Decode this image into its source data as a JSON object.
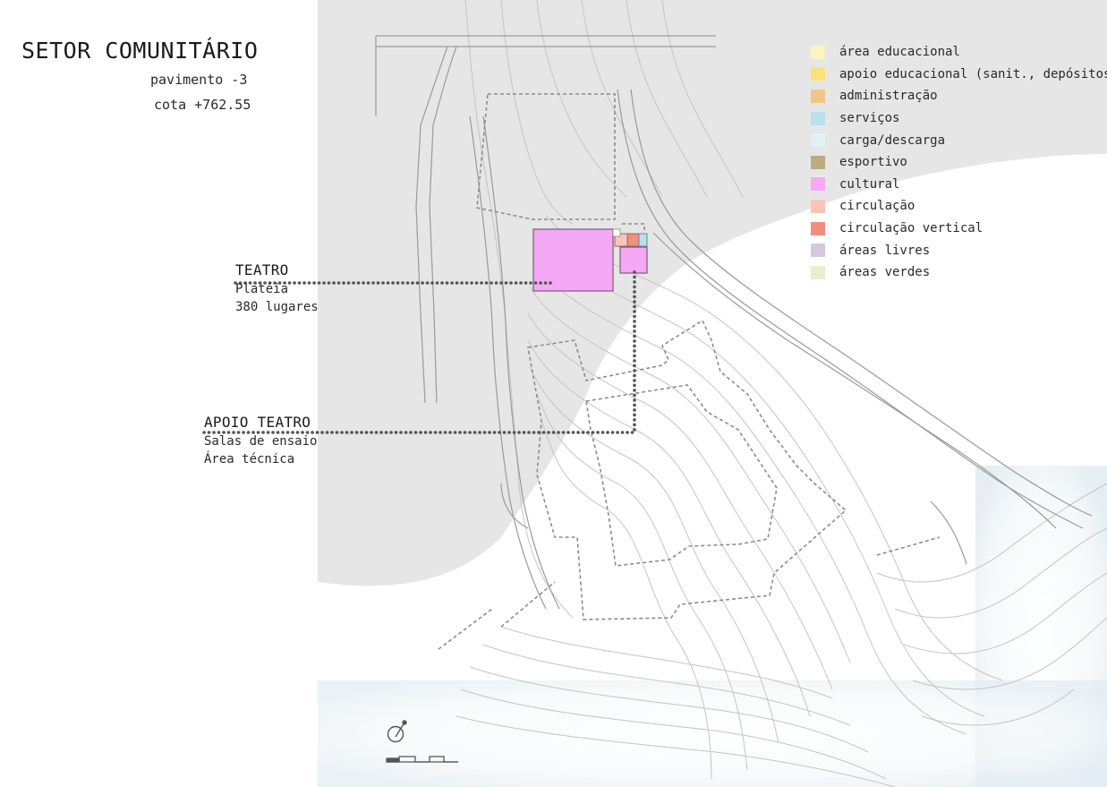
{
  "header": {
    "title": "SETOR COMUNITÁRIO",
    "level": "pavimento -3",
    "elevation": "cota +762.55"
  },
  "callouts": {
    "teatro": {
      "title": "TEATRO",
      "lines": [
        "Platéia",
        "380 lugares"
      ]
    },
    "apoio": {
      "title": "APOIO TEATRO",
      "lines": [
        "Salas de ensaio",
        "Área técnica"
      ]
    }
  },
  "legend": [
    {
      "label": "área educacional",
      "color": "#fbf3c0"
    },
    {
      "label": "apoio educacional (sanit., depósitos)",
      "color": "#f9e27e"
    },
    {
      "label": "administração",
      "color": "#f0c48a"
    },
    {
      "label": "serviços",
      "color": "#b7e1ee"
    },
    {
      "label": "carga/descarga",
      "color": "#dff2f3"
    },
    {
      "label": "esportivo",
      "color": "#bfaa83"
    },
    {
      "label": "cultural",
      "color": "#f5a9f5"
    },
    {
      "label": "circulação",
      "color": "#f7c6ba"
    },
    {
      "label": "circulação vertical",
      "color": "#f08f7c"
    },
    {
      "label": "áreas livres",
      "color": "#d5c7e0"
    },
    {
      "label": "áreas verdes",
      "color": "#e5f0cc"
    }
  ],
  "colors": {
    "site_shade": "#e6e6e6",
    "cultural": "#f5a9f5",
    "circulation": "#f7c6ba",
    "vertical_circulation": "#f08f7c",
    "services": "#b7e1ee",
    "leader_line": "#555555",
    "contour": "#c4c4c4"
  },
  "icons": {
    "north": "north-arrow-icon",
    "scale": "scale-bar-icon"
  }
}
